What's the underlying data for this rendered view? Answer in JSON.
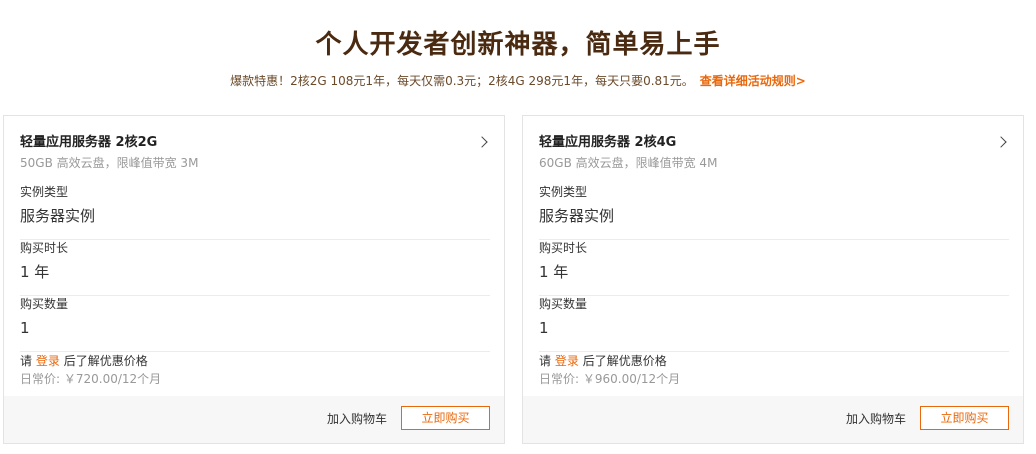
{
  "header": {
    "title": "个人开发者创新神器，简单易上手",
    "promo_text": "爆款特惠！2核2G 108元1年，每天仅需0.3元；2核4G 298元1年，每天只要0.81元。",
    "promo_link": "查看详细活动规则>"
  },
  "colors": {
    "accent": "#e9680c",
    "title": "#4a2a10"
  },
  "cards": [
    {
      "title": "轻量应用服务器 2核2G",
      "subtitle": "50GB 高效云盘，限峰值带宽 3M",
      "fields": [
        {
          "label": "实例类型",
          "value": "服务器实例"
        },
        {
          "label": "购买时长",
          "value": "1 年"
        },
        {
          "label": "购买数量",
          "value": "1"
        }
      ],
      "login_prefix": "请",
      "login_link": "登录",
      "login_suffix": "后了解优惠价格",
      "regular_price": "日常价: ￥720.00/12个月",
      "cart_label": "加入购物车",
      "buy_label": "立即购买"
    },
    {
      "title": "轻量应用服务器 2核4G",
      "subtitle": "60GB 高效云盘，限峰值带宽 4M",
      "fields": [
        {
          "label": "实例类型",
          "value": "服务器实例"
        },
        {
          "label": "购买时长",
          "value": "1 年"
        },
        {
          "label": "购买数量",
          "value": "1"
        }
      ],
      "login_prefix": "请",
      "login_link": "登录",
      "login_suffix": "后了解优惠价格",
      "regular_price": "日常价: ￥960.00/12个月",
      "cart_label": "加入购物车",
      "buy_label": "立即购买"
    }
  ]
}
